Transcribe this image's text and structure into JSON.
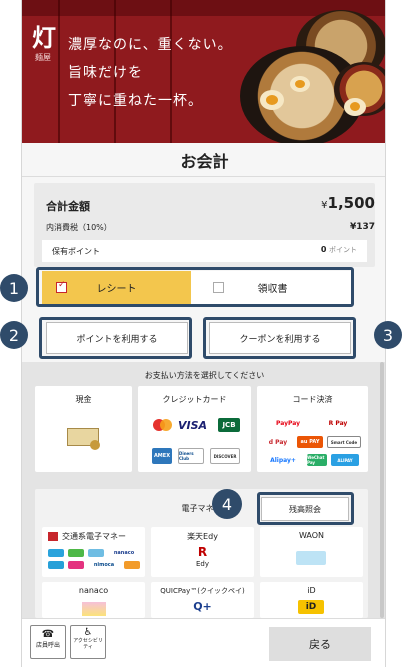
{
  "banner": {
    "brand_glyph": "灯",
    "brand_sub": "麺屋",
    "tagline": [
      "濃厚なのに、重くない。",
      "旨味だけを",
      "丁寧に重ねた一杯。"
    ]
  },
  "screen": {
    "title": "お会計"
  },
  "summary": {
    "total_label": "合計金額",
    "total_currency": "¥",
    "total_value": "1,500",
    "tax_label": "内消費税（10%）",
    "tax_value": "¥137",
    "points_label": "保有ポイント",
    "points_value": "0",
    "points_unit": "ポイント"
  },
  "receipt": {
    "receipt_label": "レシート",
    "invoice_label": "領収書"
  },
  "actions": {
    "use_points": "ポイントを利用する",
    "use_coupon": "クーポンを利用する"
  },
  "payment": {
    "prompt": "お支払い方法を選択してください",
    "cash": "現金",
    "credit": "クレジットカード",
    "code": "コード決済",
    "credit_brands": [
      "VISA",
      "JCB",
      "AMEX",
      "Diners Club",
      "DISCOVER"
    ],
    "code_brands": [
      "PayPay",
      "R Pay",
      "d Pay",
      "au PAY",
      "Smart Code",
      "Alipay+",
      "ALIPAY",
      "WeChat Pay"
    ],
    "emoney_section": "電子マネー",
    "balance_inquiry": "残高照会",
    "transit": "交通系電子マネー",
    "transit_brands": [
      "nanaco",
      "nimoca"
    ],
    "edy": "楽天Edy",
    "edy_logo": "R",
    "edy_sub": "Edy",
    "waon": "WAON",
    "nanaco": "nanaco",
    "quicpay": "QUICPay™(クイックペイ)",
    "quicpay_logo": "Q+",
    "id": "iD",
    "id_logo": "iD"
  },
  "annotations": {
    "one": "1",
    "two": "2",
    "three": "3",
    "four": "4"
  },
  "footer": {
    "staff_call": "店員呼出",
    "accessibility": "アクセシビリティ",
    "back": "戻る"
  },
  "colors": {
    "banner": "#8f1a1e",
    "accent_yellow": "#f3c64d",
    "highlight": "#2f4b6a",
    "checkbox_red": "#c7262c"
  }
}
